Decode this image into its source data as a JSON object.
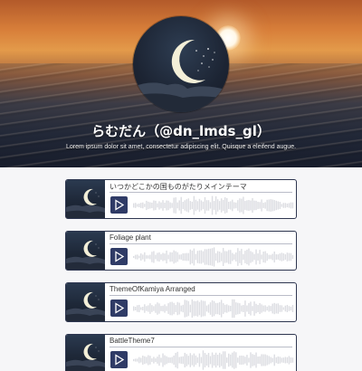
{
  "profile": {
    "name": "らむだん（@dn_lmds_gl）",
    "bio": "Lorem ipsum dolor sit amet, consectetur adipiscing elit. Quisque a eleifend augue."
  },
  "tracks": [
    {
      "title": "いつかどこかの国ものがたりメインテーマ"
    },
    {
      "title": "Foliage plant"
    },
    {
      "title": "ThemeOfKamiya Arranged"
    },
    {
      "title": "BattleTheme7"
    }
  ],
  "colors": {
    "play_button": "#2f3b66",
    "card_border": "#2e3650",
    "waveform": "#dcdde2"
  },
  "icons": {
    "play": "play-icon",
    "moon": "moon-icon"
  }
}
